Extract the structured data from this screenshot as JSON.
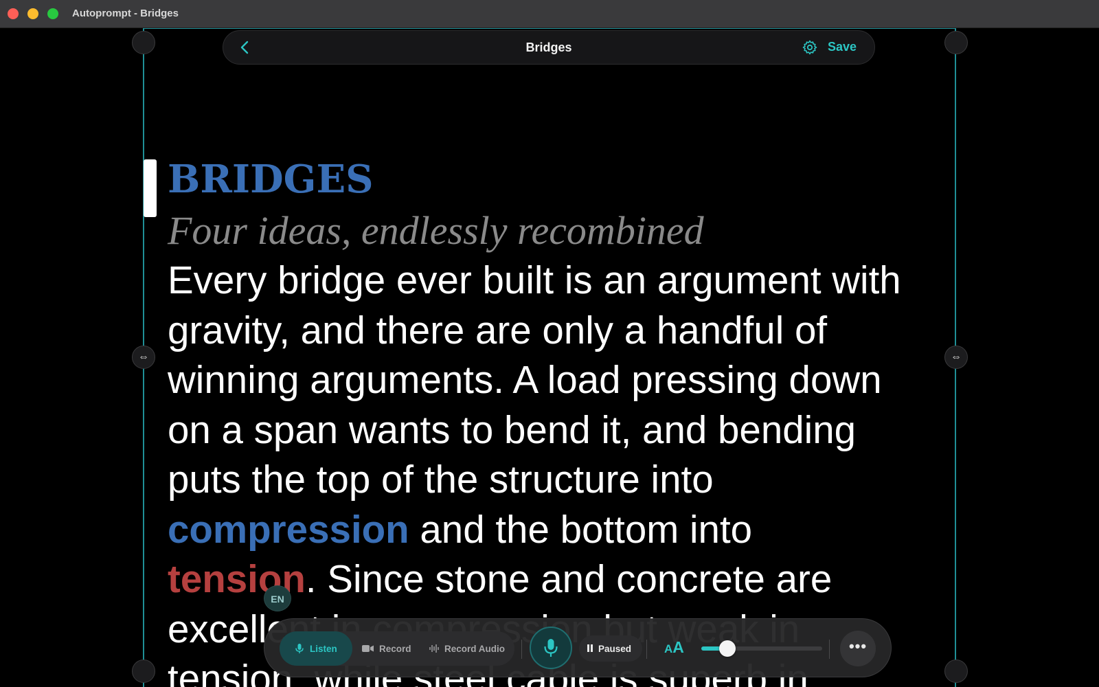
{
  "window": {
    "title": "Autoprompt - Bridges"
  },
  "topbar": {
    "back_icon": "chevron-left-icon",
    "title": "Bridges",
    "settings_icon": "gear-icon",
    "save_label": "Save"
  },
  "script": {
    "title": "BRIDGES",
    "subtitle": "Four ideas, endlessly recombined",
    "lines": [
      "Every bridge ever built is an argument with",
      "gravity, and there are only a handful of",
      "winning arguments. A load pressing down",
      "on a span wants to bend it, and bending",
      "puts the top of the structure into"
    ],
    "line6_keyword": "compression",
    "line6_rest": " and the bottom into",
    "line7_keyword": "tension",
    "line7_rest": ". Since stone and concrete are",
    "line8": "excellent in compression but weak in",
    "line9": "tension, while steel cable is superb in",
    "keyword_colors": {
      "compression": "#3a6fb6",
      "tension": "#b5403f"
    }
  },
  "language_badge": "EN",
  "controls": {
    "listen_label": "Listen",
    "record_label": "Record",
    "record_audio_label": "Record Audio",
    "status_label": "Paused",
    "font_size_icon_small": "A",
    "font_size_icon_big": "A",
    "font_size_level": 0.15,
    "more_label": "•••"
  },
  "colors": {
    "accent": "#2cc6c4",
    "frame": "#1f8f96",
    "background": "#000000"
  }
}
